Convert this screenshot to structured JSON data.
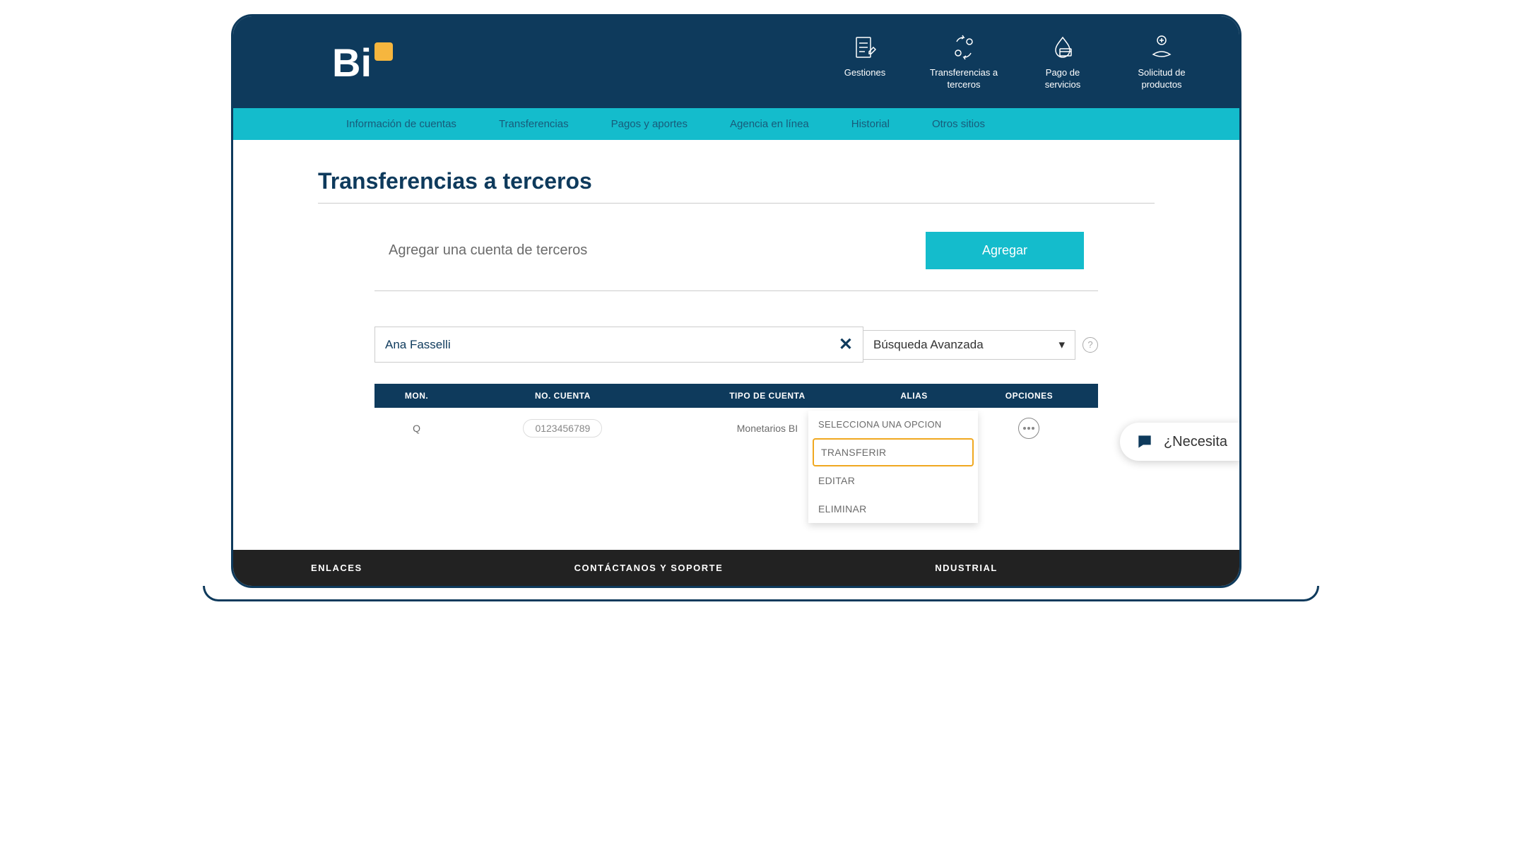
{
  "logo_text": "Bi",
  "top_actions": [
    {
      "label": "Gestiones"
    },
    {
      "label": "Transferencias a terceros"
    },
    {
      "label": "Pago de servicios"
    },
    {
      "label": "Solicitud de productos"
    }
  ],
  "menubar": [
    "Información de cuentas",
    "Transferencias",
    "Pagos y aportes",
    "Agencia en línea",
    "Historial",
    "Otros sitios"
  ],
  "page_title": "Transferencias a terceros",
  "add_section": {
    "label": "Agregar una cuenta de terceros",
    "button": "Agregar"
  },
  "search": {
    "value": "Ana Fasselli",
    "advanced_label": "Búsqueda Avanzada"
  },
  "table": {
    "headers": [
      "MON.",
      "NO. CUENTA",
      "TIPO DE CUENTA",
      "ALIAS",
      "OPCIONES"
    ],
    "row": {
      "mon": "Q",
      "account": "0123456789",
      "type": "Monetarios BI"
    }
  },
  "dropdown": {
    "header": "SELECCIONA UNA OPCION",
    "items": [
      "TRANSFERIR",
      "EDITAR",
      "ELIMINAR"
    ],
    "active_index": 0
  },
  "footer": {
    "links": "ENLACES",
    "contact": "CONTÁCTANOS Y SOPORTE",
    "right": "NDUSTRIAL"
  },
  "chat_label": "¿Necesita"
}
